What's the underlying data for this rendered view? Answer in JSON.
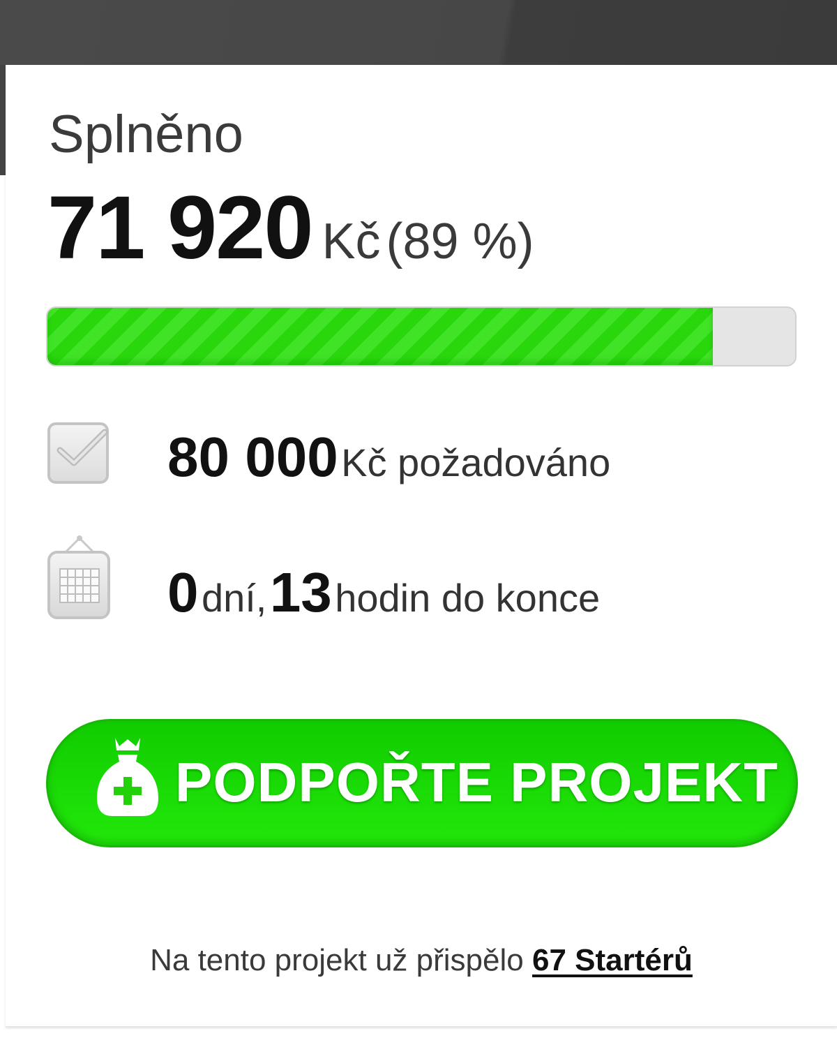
{
  "status": {
    "heading": "Splněno",
    "amount": "71 920",
    "currency": "Kč",
    "percent_text": "(89 %)",
    "progress_fraction": 0.89
  },
  "goal": {
    "value": "80 000",
    "suffix": "Kč požadováno",
    "icon": "checkbox-icon"
  },
  "time_left": {
    "days_value": "0",
    "days_label": "dní,",
    "hours_value": "13",
    "hours_label": "hodin do konce",
    "icon": "calendar-icon"
  },
  "cta": {
    "label": "PODPOŘTE PROJEKT",
    "icon": "money-bag-plus-icon"
  },
  "footer": {
    "text": "Na tento projekt už přispělo",
    "backers_link": "67 Startérů"
  },
  "colors": {
    "accent_green": "#22e80a",
    "progress_track": "#e5e5e5",
    "topbar": "#474747"
  }
}
